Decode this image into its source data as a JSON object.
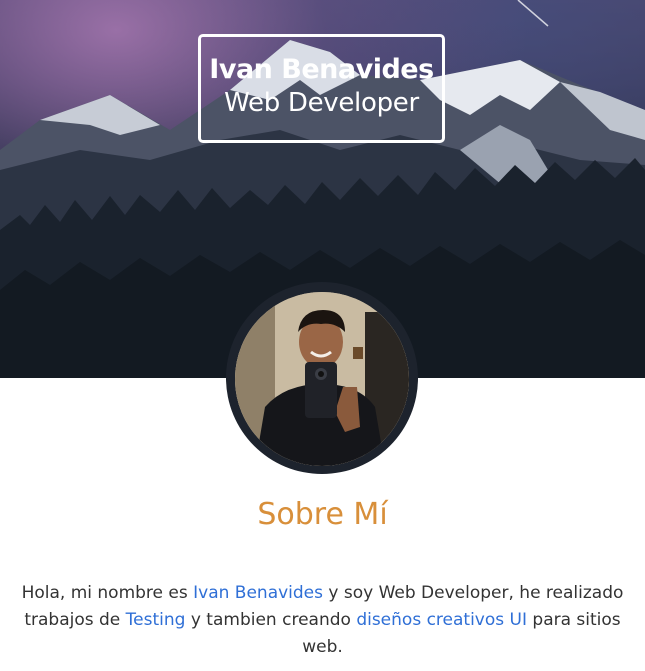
{
  "hero": {
    "name": "Ivan Benavides",
    "role": "Web Developer"
  },
  "avatar": {
    "icon": "profile-photo"
  },
  "about": {
    "title": "Sobre Mí",
    "text_1": "Hola, mi nombre es ",
    "link_name": "Ivan Benavides",
    "text_2": " y soy Web Developer, he realizado trabajos de ",
    "link_testing": "Testing",
    "text_3": " y tambien creando ",
    "link_ui": "diseños creativos UI",
    "text_4": " para sitios web."
  },
  "colors": {
    "accent": "#d88f3a",
    "link": "#2f6fd6",
    "text": "#333333"
  }
}
